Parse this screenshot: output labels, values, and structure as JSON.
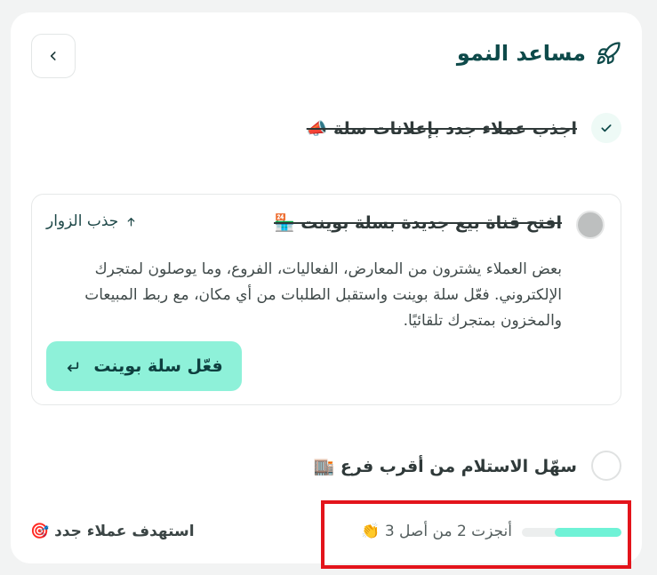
{
  "header": {
    "title": "مساعد النمو"
  },
  "steps": [
    {
      "label": "اجذب عملاء جدد بإعلانات سلة 📣",
      "done": true
    },
    {
      "label": "افتح قناة بيع جديدة بسلة بوينت 🏪",
      "tag": "جذب الزوار",
      "description": "بعض العملاء يشترون من المعارض، الفعاليات، الفروع، وما يوصلون لمتجرك الإلكتروني. فعّل سلة بوينت واستقبل الطلبات من أي مكان، مع ربط المبيعات والمخزون بمتجرك تلقائيًا.",
      "cta_label": "فعّل سلة بوينت"
    },
    {
      "label": "سهّل الاستلام من أقرب فرع 🏬",
      "done": false
    }
  ],
  "footer": {
    "goal_label": "استهدف عملاء جدد 🎯",
    "progress_text": "أنجزت 2 من أصل 3 👏",
    "progress_fraction": 0.67
  },
  "colors": {
    "accent": "#6ff2d6",
    "cta_bg": "#8ef1d9",
    "highlight": "#e3141b"
  }
}
